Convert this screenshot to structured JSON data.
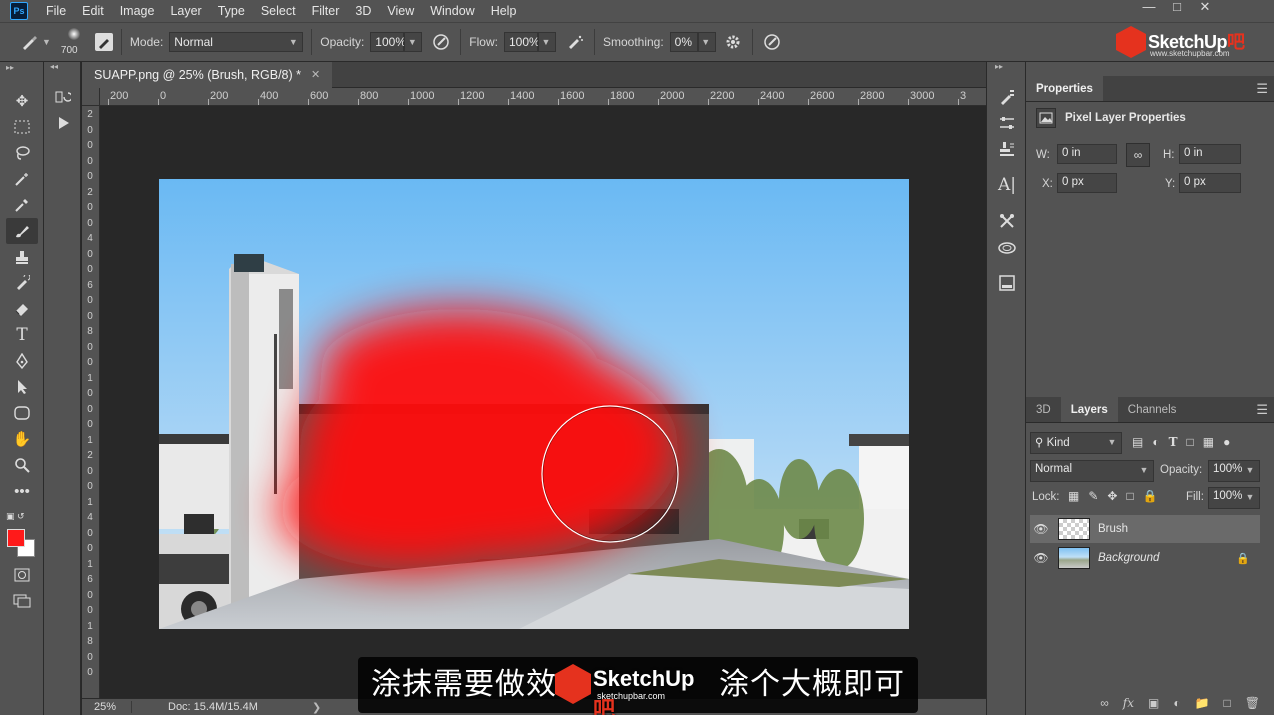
{
  "app": {
    "logo": "Ps",
    "menu": [
      "File",
      "Edit",
      "Image",
      "Layer",
      "Type",
      "Select",
      "Filter",
      "3D",
      "View",
      "Window",
      "Help"
    ]
  },
  "options": {
    "brush_size": "700",
    "mode_label": "Mode:",
    "mode_value": "Normal",
    "opacity_label": "Opacity:",
    "opacity_value": "100%",
    "flow_label": "Flow:",
    "flow_value": "100%",
    "smoothing_label": "Smoothing:",
    "smoothing_value": "0%"
  },
  "brand": {
    "name_a": "SketchUp",
    "name_b": "吧",
    "url": "www.sketchupbar.com"
  },
  "document": {
    "tab_title": "SUAPP.png @ 25% (Brush, RGB/8) *",
    "ruler_ticks": [
      "200",
      "0",
      "200",
      "400",
      "600",
      "800",
      "1000",
      "1200",
      "1400",
      "1600",
      "1800",
      "2000",
      "2200",
      "2400",
      "2600",
      "2800",
      "3000",
      "3"
    ],
    "vruler_labels": [
      "2",
      "0",
      "0",
      "0",
      "0",
      "2",
      "0",
      "0",
      "4",
      "0",
      "0",
      "6",
      "0",
      "0",
      "8",
      "0",
      "0",
      "1",
      "0",
      "0",
      "0",
      "1",
      "2",
      "0",
      "0",
      "1",
      "4",
      "0",
      "0",
      "1",
      "6",
      "0",
      "0",
      "1",
      "8",
      "0",
      "0"
    ],
    "zoom": "25%",
    "doc_info": "Doc: 15.4M/15.4M"
  },
  "tools": {
    "colors": {
      "foreground": "#ff1a1a",
      "background": "#ffffff"
    }
  },
  "properties": {
    "tab": "Properties",
    "title": "Pixel Layer Properties",
    "w_label": "W:",
    "w_value": "0 in",
    "h_label": "H:",
    "h_value": "0 in",
    "x_label": "X:",
    "x_value": "0 px",
    "y_label": "Y:",
    "y_value": "0 px"
  },
  "layers_panel": {
    "tabs": [
      "3D",
      "Layers",
      "Channels"
    ],
    "kind": "Kind",
    "blend": "Normal",
    "opacity_label": "Opacity:",
    "opacity_value": "100%",
    "lock_label": "Lock:",
    "fill_label": "Fill:",
    "fill_value": "100%",
    "layers": [
      {
        "name": "Brush",
        "selected": true
      },
      {
        "name": "Background",
        "selected": false
      }
    ]
  },
  "subtitle": {
    "text_before": "涂抹需要做效",
    "text_after": "涂个大概即可",
    "wm_name_a": "SketchUp",
    "wm_name_b": "吧",
    "wm_url": "sketchupbar.com"
  }
}
